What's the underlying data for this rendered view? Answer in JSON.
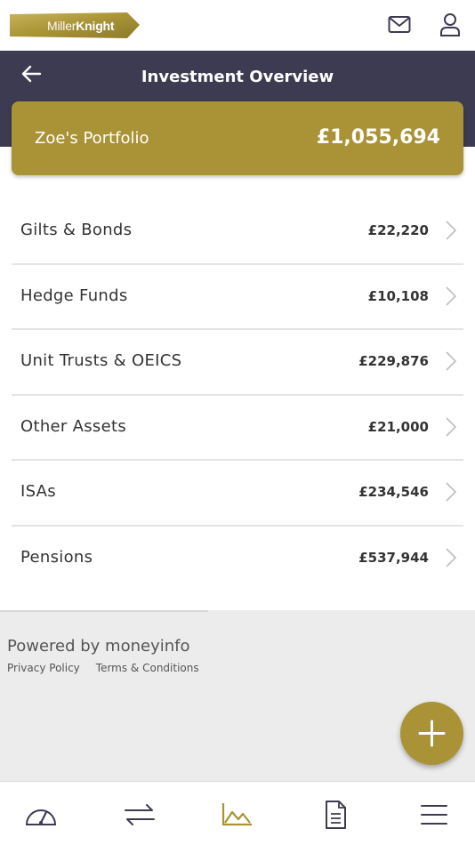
{
  "brand": {
    "logo_text_light": "Miller",
    "logo_text_bold": "Knight",
    "color": "#a99336"
  },
  "header": {
    "title": "Investment Overview",
    "bg": "#3d3b52"
  },
  "portfolio": {
    "name": "Zoe's Portfolio",
    "total": "£1,055,694"
  },
  "assets": [
    {
      "label": "Gilts & Bonds",
      "value": "£22,220"
    },
    {
      "label": "Hedge Funds",
      "value": "£10,108"
    },
    {
      "label": "Unit Trusts & OEICS",
      "value": "£229,876"
    },
    {
      "label": "Other Assets",
      "value": "£21,000"
    },
    {
      "label": "ISAs",
      "value": "£234,546"
    },
    {
      "label": "Pensions",
      "value": "£537,944"
    }
  ],
  "footer": {
    "powered_by": "Powered by moneyinfo",
    "privacy": "Privacy Policy",
    "terms": "Terms & Conditions"
  },
  "nav": {
    "items": [
      "dashboard-icon",
      "transfer-icon",
      "chart-icon",
      "document-icon",
      "menu-icon"
    ],
    "active_index": 2
  }
}
